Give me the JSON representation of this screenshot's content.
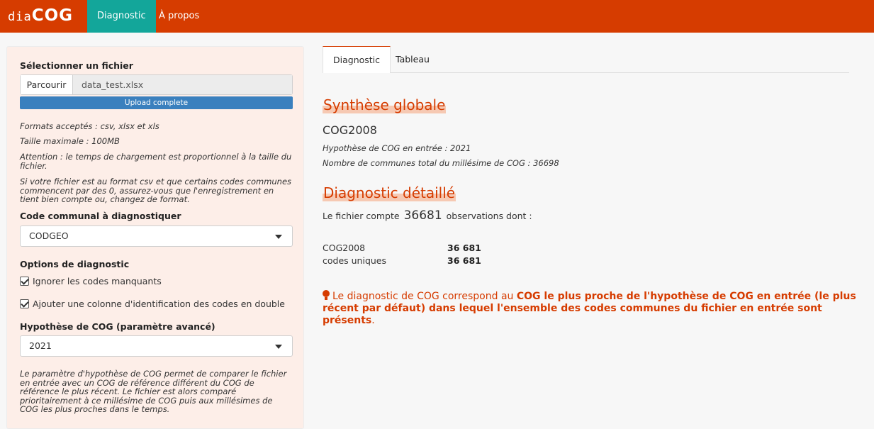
{
  "app": {
    "brand_prefix": "dia",
    "brand_main": "COG"
  },
  "nav": {
    "items": [
      "Diagnostic",
      "À propos"
    ],
    "active": "Diagnostic"
  },
  "sidebar": {
    "file_label": "Sélectionner un fichier",
    "browse_label": "Parcourir",
    "file_name": "data_test.xlsx",
    "upload_status": "Upload complete",
    "upload_progress_percent": 100,
    "notes": [
      "Formats acceptés : csv, xlsx et xls",
      "Taille maximale : 100MB",
      "Attention : le temps de chargement est proportionnel à la taille du fichier.",
      "Si votre fichier est au format csv et que certains codes communes commencent par des 0, assurez-vous que l'enregistrement en tient bien compte ou, changez de format."
    ],
    "code_label": "Code communal à diagnostiquer",
    "code_selected": "CODGEO",
    "options_label": "Options de diagnostic",
    "options": [
      {
        "label": "Ignorer les codes manquants",
        "checked": true
      },
      {
        "label": "Ajouter une colonne d'identification des codes en double",
        "checked": true
      }
    ],
    "hyp_label": "Hypothèse de COG (paramètre avancé)",
    "hyp_selected": "2021",
    "hyp_note": "Le paramètre d'hypothèse de COG permet de comparer le fichier en entrée avec un COG de référence différent du COG de référence le plus récent. Le fichier est alors comparé prioritairement à ce millésime de COG puis aux millésimes de COG les plus proches dans le temps."
  },
  "tabs": {
    "items": [
      "Diagnostic",
      "Tableau"
    ],
    "active": "Diagnostic"
  },
  "main": {
    "synthese_title": "Synthèse globale",
    "cog_result": "COG2008",
    "hyp_line": "Hypothèse de COG en entrée : 2021",
    "communes_line": "Nombre de communes total du millésime de COG : 36698",
    "detail_title": "Diagnostic détaillé",
    "obs_prefix": "Le fichier compte",
    "obs_count": "36681",
    "obs_suffix": "observations dont :",
    "table": [
      {
        "label": "COG2008",
        "value": "36 681"
      },
      {
        "label": "codes uniques",
        "value": "36 681"
      }
    ],
    "info_part1": "Le diagnostic de COG correspond au",
    "info_bold": "COG le plus proche de l'hypothèse de COG en entrée (le plus récent par défaut) dans lequel l'ensemble des codes communes du fichier en entrée sont présents",
    "info_end": ".",
    "info_icon": "lightbulb-icon"
  },
  "colors": {
    "accent": "#d63c00",
    "nav_active": "#13a69a",
    "progress": "#3a80be",
    "sidebar_bg": "#fdeee8"
  }
}
